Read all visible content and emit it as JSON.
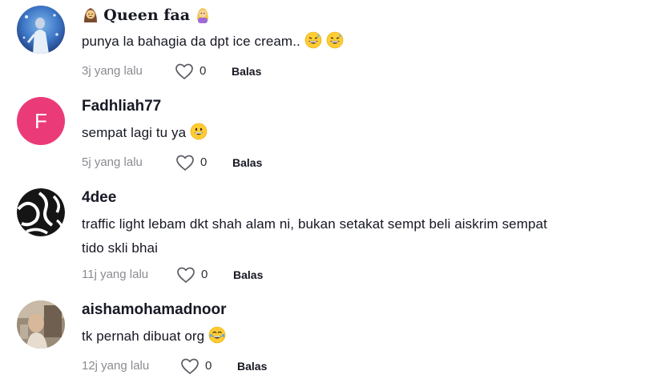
{
  "comments": [
    {
      "username": "Queen faa",
      "text": "punya la bahagia da dpt ice cream..",
      "time": "3j yang lalu",
      "likes": "0",
      "reply_label": "Balas"
    },
    {
      "username": "Fadhliah77",
      "avatar_letter": "F",
      "text": "sempat lagi tu ya",
      "time": "5j yang lalu",
      "likes": "0",
      "reply_label": "Balas"
    },
    {
      "username": "4dee",
      "text_line1": "traffic light lebam dkt shah alam ni, bukan setakat sempt beli aiskrim sempat",
      "text_line2": "tido skli bhai",
      "time": "11j yang lalu",
      "likes": "0",
      "reply_label": "Balas"
    },
    {
      "username": "aishamohamadnoor",
      "text": "tk pernah dibuat org",
      "time": "12j yang lalu",
      "likes": "0",
      "reply_label": "Balas"
    }
  ],
  "colors": {
    "primary_text": "#161823",
    "secondary_text": "#8a8b91",
    "avatar_pink": "#ea3b78"
  }
}
